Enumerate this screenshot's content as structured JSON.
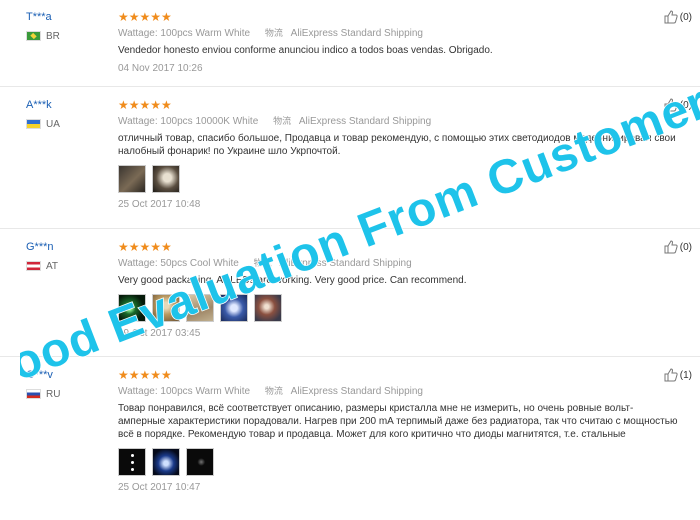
{
  "reviews": [
    {
      "user": "T***a",
      "country": "BR",
      "stars": "★★★★★",
      "wattage": "Wattage: 100pcs Warm White",
      "ship_icon": "物流",
      "shipping": "AliExpress Standard Shipping",
      "text": "Vendedor honesto enviou conforme anunciou indico a todos boas vendas. Obrigado.",
      "date": "04 Nov 2017 10:26",
      "useful": "(0)"
    },
    {
      "user": "A***k",
      "country": "UA",
      "stars": "★★★★★",
      "wattage": "Wattage: 100pcs 10000K White",
      "ship_icon": "物流",
      "shipping": "AliExpress Standard Shipping",
      "text": "отличный товар, спасибо большое, Продавца и товар рекомендую, с помощью этих светодиодов модернизировал свои налобный фонарик! по Украине шло Укрпочтой.",
      "date": "25 Oct 2017 10:48",
      "useful": "(0)"
    },
    {
      "user": "G***n",
      "country": "AT",
      "stars": "★★★★★",
      "wattage": "Wattage: 50pcs Cool White",
      "ship_icon": "物流",
      "shipping": "AliExpress Standard Shipping",
      "text": "Very good packaging. All LEDs are working. Very good price. Can recommend.",
      "date": "09 Oct 2017 03:45",
      "useful": "(0)"
    },
    {
      "user": "O***v",
      "country": "RU",
      "stars": "★★★★★",
      "wattage": "Wattage: 100pcs Warm White",
      "ship_icon": "物流",
      "shipping": "AliExpress Standard Shipping",
      "text": "Товар понравился, всё соответствует описанию, размеры кристалла мне не измерить, но очень ровные вольт-амперные характеристики порадовали. Нагрев при 200 mA терпимый даже без радиатора, так что считаю с мощностью всё в порядке. Рекомендую товар и продавца. Может для кого критично что диоды магнитятся, т.е. стальные",
      "date": "25 Oct 2017 10:47",
      "useful": "(1)"
    }
  ],
  "watermark": "Good Evaluation From Customers",
  "colors": {
    "star": "#f08c1c",
    "watermark": "#1ec3ea",
    "username": "#1a5fb4"
  }
}
